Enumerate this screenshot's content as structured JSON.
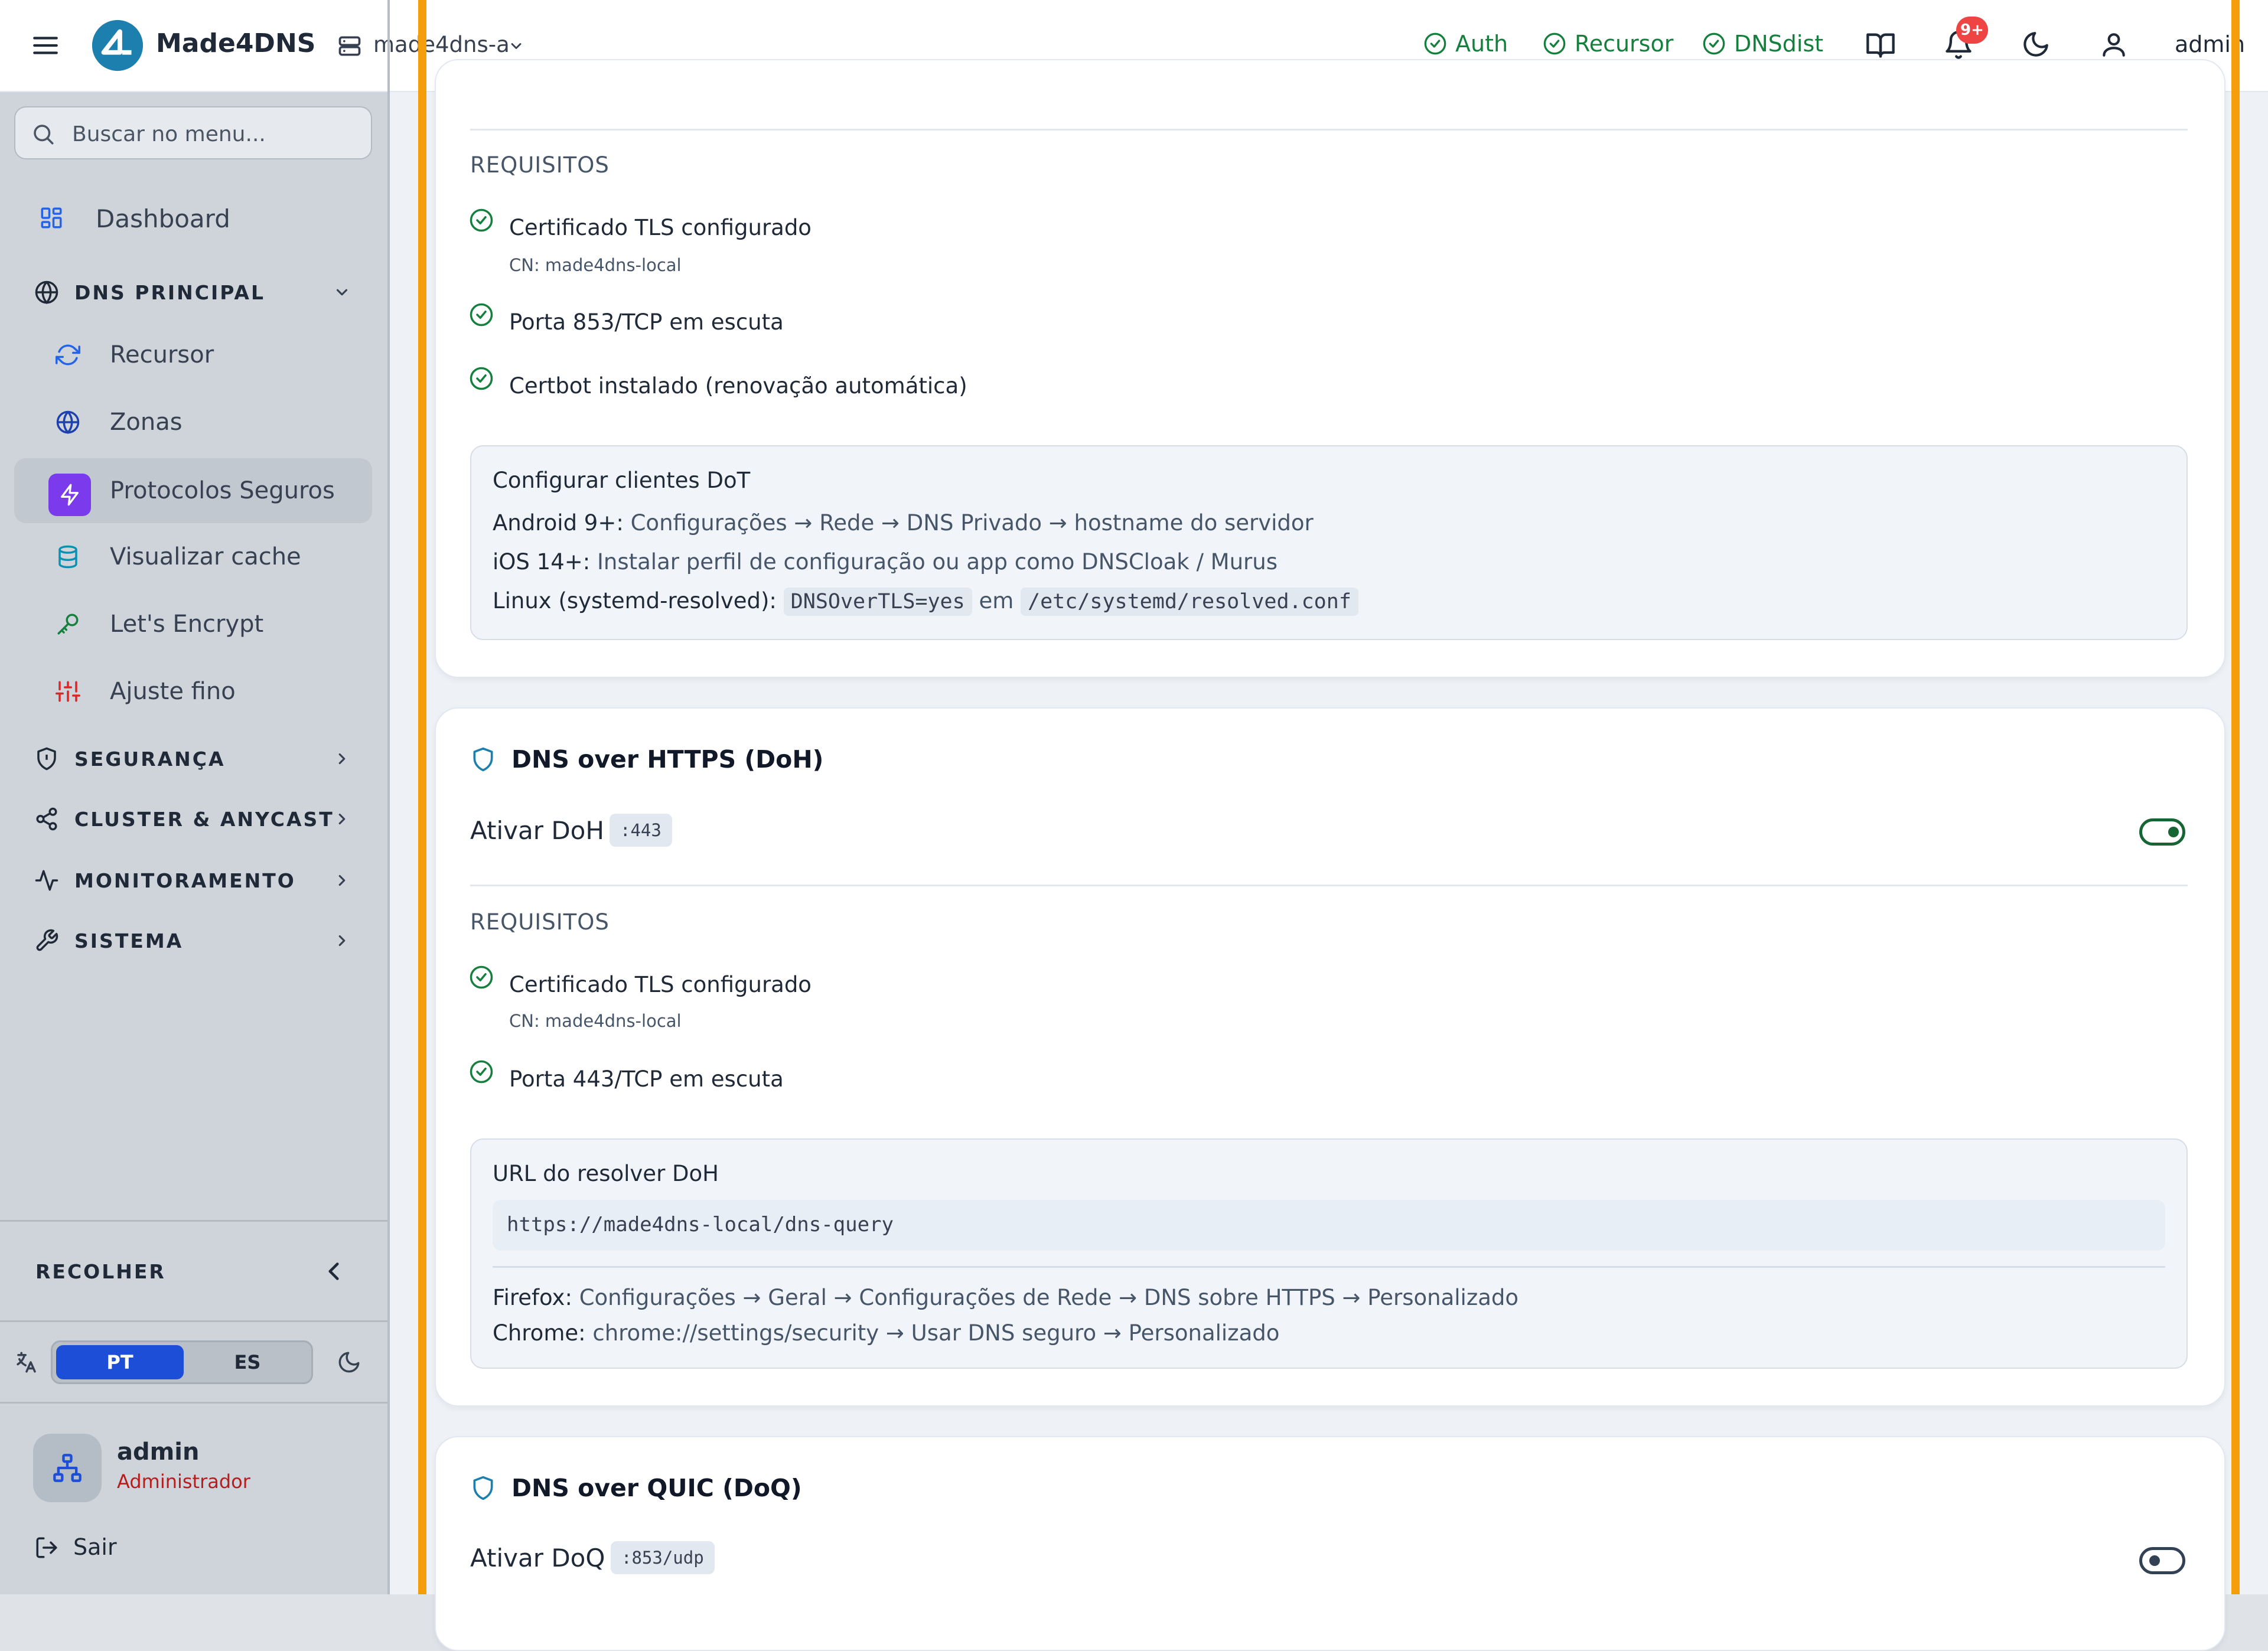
{
  "header": {
    "brand": "Made4DNS",
    "server_name": "made4dns-a",
    "status": [
      {
        "label": "Auth",
        "state": "ok"
      },
      {
        "label": "Recursor",
        "state": "ok"
      },
      {
        "label": "DNSdist",
        "state": "ok"
      }
    ],
    "notification_badge": "9+",
    "user_label": "admin",
    "icons": [
      "menu-icon",
      "logo-icon",
      "server-icon",
      "chevron-down-icon",
      "check-circle-icon",
      "book-icon",
      "bell-icon",
      "moon-icon",
      "user-icon"
    ]
  },
  "sidebar": {
    "search_placeholder": "Buscar no menu...",
    "dashboard_label": "Dashboard",
    "dns_principal": {
      "label": "DNS PRINCIPAL",
      "expanded": true,
      "items": [
        {
          "label": "Recursor",
          "icon": "refresh-icon"
        },
        {
          "label": "Zonas",
          "icon": "globe-icon"
        },
        {
          "label": "Protocolos Seguros",
          "icon": "bolt-icon",
          "active": true
        },
        {
          "label": "Visualizar cache",
          "icon": "database-icon"
        },
        {
          "label": "Let's Encrypt",
          "icon": "key-icon"
        },
        {
          "label": "Ajuste fino",
          "icon": "sliders-icon"
        }
      ]
    },
    "sections": [
      {
        "label": "SEGURANÇA",
        "icon": "shield-icon"
      },
      {
        "label": "CLUSTER & ANYCAST",
        "icon": "share-icon"
      },
      {
        "label": "MONITORAMENTO",
        "icon": "activity-icon"
      },
      {
        "label": "SISTEMA",
        "icon": "wrench-icon"
      }
    ],
    "collapse_label": "RECOLHER",
    "languages": [
      "PT",
      "ES"
    ],
    "selected_language": "PT",
    "user": {
      "name": "admin",
      "role": "Administrador"
    },
    "logout_label": "Sair"
  },
  "dot": {
    "requirements_title": "REQUISITOS",
    "requirements": [
      {
        "text": "Certificado TLS configurado",
        "sub": "CN: made4dns-local"
      },
      {
        "text": "Porta 853/TCP em escuta"
      },
      {
        "text": "Certbot instalado (renovação automática)"
      }
    ],
    "clients": {
      "title": "Configurar clientes DoT",
      "android_label": "Android 9+:",
      "android_text": "Configurações → Rede → DNS Privado → hostname do servidor",
      "ios_label": "iOS 14+:",
      "ios_text": "Instalar perfil de configuração ou app como DNSCloak / Murus",
      "linux_label": "Linux (systemd-resolved):",
      "linux_code": "DNSOverTLS=yes",
      "linux_mid": "em",
      "linux_path": "/etc/systemd/resolved.conf"
    }
  },
  "doh": {
    "title": "DNS over HTTPS (DoH)",
    "toggle_label": "Ativar DoH",
    "port": ":443",
    "enabled": true,
    "requirements_title": "REQUISITOS",
    "requirements": [
      {
        "text": "Certificado TLS configurado",
        "sub": "CN: made4dns-local"
      },
      {
        "text": "Porta 443/TCP em escuta"
      }
    ],
    "resolver": {
      "title": "URL do resolver DoH",
      "url": "https://made4dns-local/dns-query",
      "firefox_label": "Firefox:",
      "firefox_text": "Configurações → Geral → Configurações de Rede → DNS sobre HTTPS → Personalizado",
      "chrome_label": "Chrome:",
      "chrome_text": "chrome://settings/security → Usar DNS seguro → Personalizado"
    }
  },
  "doq": {
    "title": "DNS over QUIC (DoQ)",
    "toggle_label": "Ativar DoQ",
    "port": ":853/udp",
    "enabled": false
  },
  "colors": {
    "accent_orange": "#f59e0b",
    "active_purple": "#7c3aed",
    "status_green": "#15803d",
    "toggle_on": "#166534",
    "badge_red": "#ef4444",
    "language_active": "#1d4ed8"
  }
}
